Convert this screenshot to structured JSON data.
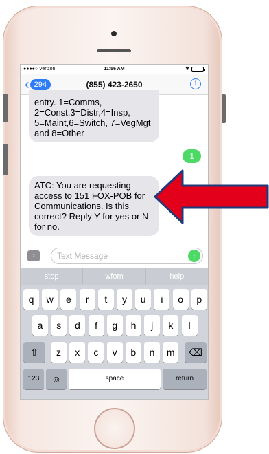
{
  "status_bar": {
    "carrier": "●●●●○ Verizon",
    "time": "11:56 AM",
    "bluetooth": "✱"
  },
  "nav": {
    "back_count": "294",
    "title": "(855) 423-2650",
    "info_label": "i"
  },
  "messages": {
    "incoming_1": "entry. 1=Comms, 2=Const,3=Distr,4=Insp, 5=Maint,6=Switch, 7=VegMgt and 8=Other",
    "outgoing_1": "1",
    "incoming_2": "ATC: You are requesting access to 151  FOX-POB for Communications. Is this correct? Reply Y for yes or N for no."
  },
  "compose": {
    "placeholder": "Text Message",
    "value": ""
  },
  "keyboard": {
    "suggestions": [
      "stop",
      "wfom",
      "help"
    ],
    "row1": [
      "q",
      "w",
      "e",
      "r",
      "t",
      "y",
      "u",
      "i",
      "o",
      "p"
    ],
    "row2": [
      "a",
      "s",
      "d",
      "f",
      "g",
      "h",
      "j",
      "k",
      "l"
    ],
    "row3": [
      "z",
      "x",
      "c",
      "v",
      "b",
      "n",
      "m"
    ],
    "numbers_key": "123",
    "space_key": "space",
    "return_key": "return"
  },
  "colors": {
    "imessage_blue": "#2e7cf6",
    "sms_green": "#4cd964",
    "arrow_red": "#e3001b",
    "arrow_outline": "#1f3a7a"
  }
}
